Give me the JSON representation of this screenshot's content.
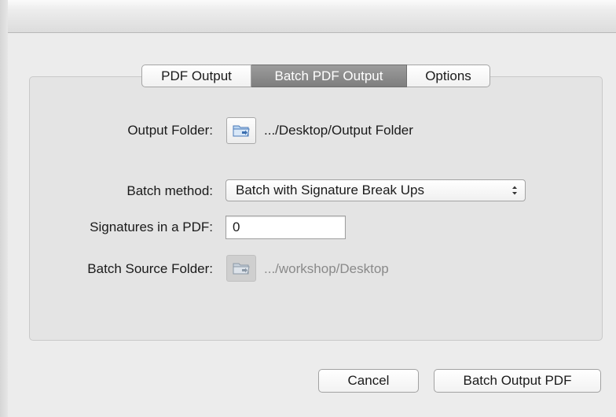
{
  "tabs": [
    {
      "label": "PDF Output",
      "selected": false
    },
    {
      "label": "Batch PDF Output",
      "selected": true
    },
    {
      "label": "Options",
      "selected": false
    }
  ],
  "output_folder": {
    "label": "Output Folder:",
    "icon": "folder-icon",
    "path": ".../Desktop/Output Folder"
  },
  "batch_method": {
    "label": "Batch method:",
    "selected": "Batch with Signature Break Ups"
  },
  "signatures": {
    "label": "Signatures in a PDF:",
    "value": "0"
  },
  "batch_source_folder": {
    "label": "Batch Source Folder:",
    "icon": "folder-icon",
    "path": ".../workshop/Desktop",
    "disabled": true
  },
  "buttons": {
    "cancel": "Cancel",
    "batch_output": "Batch Output PDF"
  },
  "colors": {
    "selected_tab": "#8a8a8a",
    "panel_bg": "#e4e4e4",
    "window_bg": "#ececec"
  }
}
